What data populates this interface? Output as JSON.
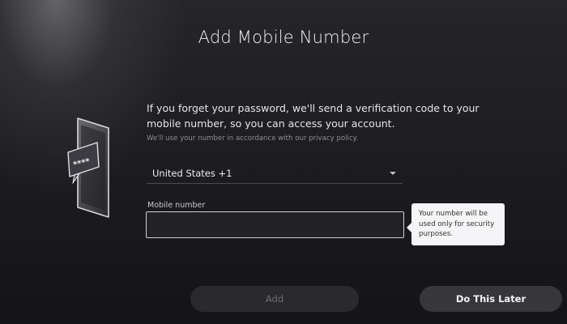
{
  "page": {
    "title": "Add Mobile Number",
    "description": "If you forget your password, we'll send a verification code to your mobile number, so you can access your account.",
    "privacy_note": "We'll use your number in accordance with our privacy policy."
  },
  "country_select": {
    "value": "United States +1"
  },
  "mobile_field": {
    "label": "Mobile number",
    "value": ""
  },
  "tooltip": {
    "text": "Your number will be used only for security purposes."
  },
  "buttons": {
    "add_label": "Add",
    "later_label": "Do This Later"
  },
  "illustration": {
    "icon": "phone-password-icon",
    "bubble_text": "****"
  },
  "colors": {
    "background": "#1c1c1f",
    "tooltip_bg": "#f5f5f7",
    "button_active": "#37373b"
  }
}
